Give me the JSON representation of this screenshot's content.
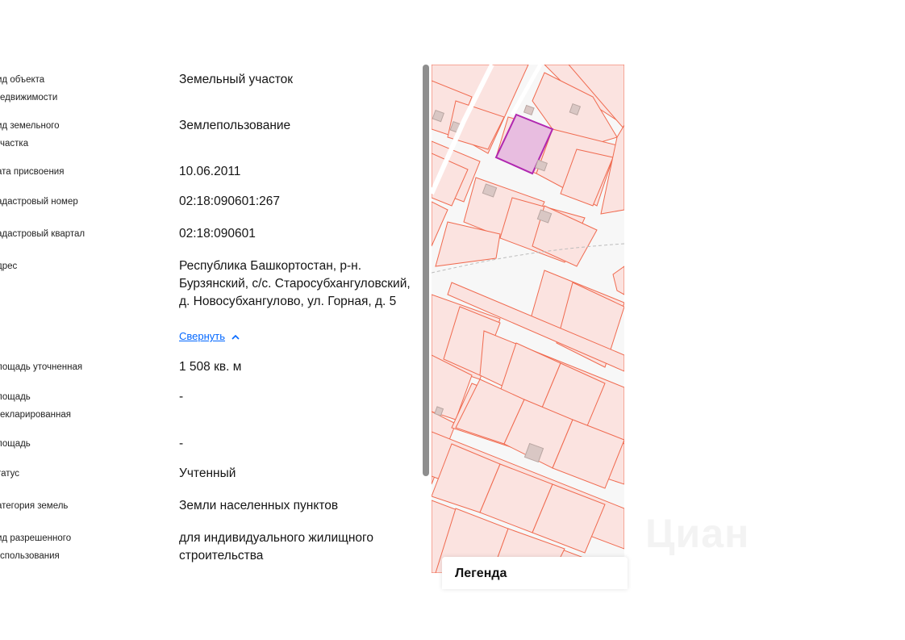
{
  "properties": [
    {
      "label": "ид объекта\nедвижимости",
      "value": "Земельный участок"
    },
    {
      "label": "ид земельного\nчастка",
      "value": "Землепользование"
    },
    {
      "label": "ата присвоения",
      "value": "10.06.2011"
    },
    {
      "label": "адастровый номер",
      "value": "02:18:090601:267"
    },
    {
      "label": "адастровый квартал",
      "value": "02:18:090601"
    },
    {
      "label": "дрес",
      "value": "Республика Башкортостан, р-н. Бурзянский, с/с. Старосубхангуловский, д. Новосубхангулово, ул. Горная, д. 5"
    },
    {
      "label": "лощадь уточненная",
      "value": "1 508 кв. м"
    },
    {
      "label": "лощадь\nекларированная",
      "value": "-"
    },
    {
      "label": "лощадь",
      "value": "-"
    },
    {
      "label": "татус",
      "value": "Учтенный"
    },
    {
      "label": "атегория земель",
      "value": "Земли населенных пунктов"
    },
    {
      "label": "ид разрешенного\nспользования",
      "value": "для индивидуального жилищного строительства"
    }
  ],
  "collapse_link": "Свернуть",
  "chevron_icon": "chevron-up-icon",
  "map": {
    "legend_title": "Легенда",
    "watermark": "Циан",
    "colors": {
      "parcel_border": "#f06a4f",
      "parcel_fill": "#fbe3e0",
      "selected_border": "#b027b0",
      "selected_fill": "#e8bde0"
    }
  }
}
